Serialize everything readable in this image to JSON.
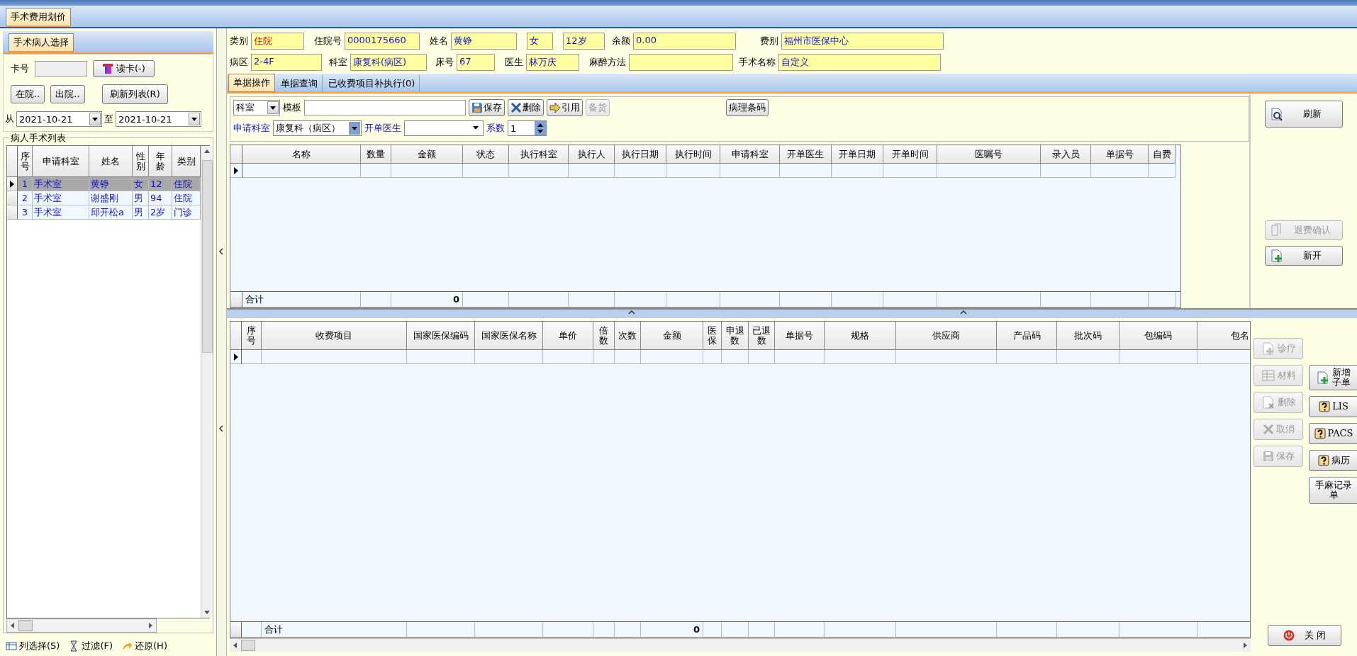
{
  "document_tabs": [
    {
      "label": "手术费用划价",
      "selected": true
    }
  ],
  "patient_panel": {
    "tab": "手术病人选择",
    "card_label": "卡号",
    "read_card_button": "读卡(-)",
    "in_hospital_button": "在院..",
    "discharged_button": "出院..",
    "refresh_button": "刷新列表(R)",
    "from_label": "从",
    "from_date": "2021-10-21",
    "to_label": "至",
    "to_date": "2021-10-21",
    "list_title": "病人手术列表",
    "columns": [
      "序号",
      "申请科室",
      "姓名",
      "性别",
      "年龄",
      "类别"
    ],
    "rows": [
      {
        "cells": [
          "1",
          "手术室",
          "黄铮",
          "女",
          "12",
          "住院"
        ],
        "selected": true
      },
      {
        "cells": [
          "2",
          "手术室",
          "谢盛刚",
          "男",
          "94",
          "住院"
        ],
        "selected": false
      },
      {
        "cells": [
          "3",
          "手术室",
          "邱开松a",
          "男",
          "2岁",
          "门诊"
        ],
        "selected": false
      }
    ],
    "footer_tools": [
      "列选择(S)",
      "过滤(F)",
      "还原(H)"
    ]
  },
  "info_rows": [
    [
      {
        "label": "类别",
        "value": "住院",
        "alert": true
      },
      {
        "label": "住院号",
        "value": "0000175660",
        "alert": false
      },
      {
        "label": "姓名",
        "value": "黄铮",
        "alert": false
      },
      {
        "value": "女",
        "alert": false
      },
      {
        "value": "12岁",
        "alert": false
      },
      {
        "label": "余额",
        "value": "0.00",
        "alert": false
      },
      {
        "label": "费别",
        "value": "福州市医保中心",
        "alert": false
      }
    ],
    [
      {
        "label": "病区",
        "value": "2-4F",
        "alert": false
      },
      {
        "label": "科室",
        "value": "康复科(病区)",
        "alert": false
      },
      {
        "label": "床号",
        "value": "67",
        "alert": false
      },
      {
        "label": "医生",
        "value": "林万庆",
        "alert": false
      },
      {
        "label": "麻醉方法"
      },
      {
        "label": "手术名称",
        "value": "自定义",
        "alert": false
      }
    ]
  ],
  "tabs": [
    {
      "label": "单据操作",
      "selected": true
    },
    {
      "label": "单据查询",
      "selected": false
    },
    {
      "label": "已收费项目补执行(0)",
      "selected": false
    }
  ],
  "toolbar": {
    "scope": "科室",
    "template_label": "模板",
    "buttons": [
      {
        "label": "保存",
        "disabled": false
      },
      {
        "label": "删除",
        "disabled": false
      },
      {
        "label": "引用",
        "disabled": false
      },
      {
        "label": "备货",
        "disabled": true
      }
    ],
    "pathology_button": "病理条码",
    "dept_label": "申请科室",
    "dept_value": "康复科（病区）",
    "doctor_label": "开单医生",
    "factor_label": "系数",
    "factor_value": "1"
  },
  "upper_grid": {
    "columns": [
      "名称",
      "数量",
      "金额",
      "状态",
      "执行科室",
      "执行人",
      "执行日期",
      "执行时间",
      "申请科室",
      "开单医生",
      "开单日期",
      "开单时间",
      "医嘱号",
      "录入员",
      "单据号",
      "自费"
    ],
    "total_label": "合计",
    "total_amount": "0"
  },
  "upper_buttons": [
    {
      "label": "刷新",
      "disabled": false
    },
    {
      "label": "退费确认",
      "disabled": true
    },
    {
      "label": "新开",
      "disabled": false
    }
  ],
  "lower_grid": {
    "columns": [
      "序号",
      "收费项目",
      "国家医保编码",
      "国家医保名称",
      "单价",
      "倍数",
      "次数",
      "金额",
      "医保",
      "申退数",
      "已退数",
      "单据号",
      "规格",
      "供应商",
      "产品码",
      "批次码",
      "包编码",
      "包名"
    ],
    "total_label": "合计",
    "total_amount": "0"
  },
  "lower_buttons_left": [
    {
      "label": "诊疗",
      "disabled": true
    },
    {
      "label": "材料",
      "disabled": true
    },
    {
      "label": "删除",
      "disabled": true
    },
    {
      "label": "取消",
      "disabled": true
    },
    {
      "label": "保存",
      "disabled": true
    }
  ],
  "lower_buttons_right": [
    {
      "label": "新增子单",
      "disabled": false
    },
    {
      "label": "LIS",
      "disabled": false
    },
    {
      "label": "PACS",
      "disabled": false
    },
    {
      "label": "病历",
      "disabled": false
    },
    {
      "label": "手麻记录单",
      "disabled": false
    }
  ],
  "close_button": "关 闭"
}
